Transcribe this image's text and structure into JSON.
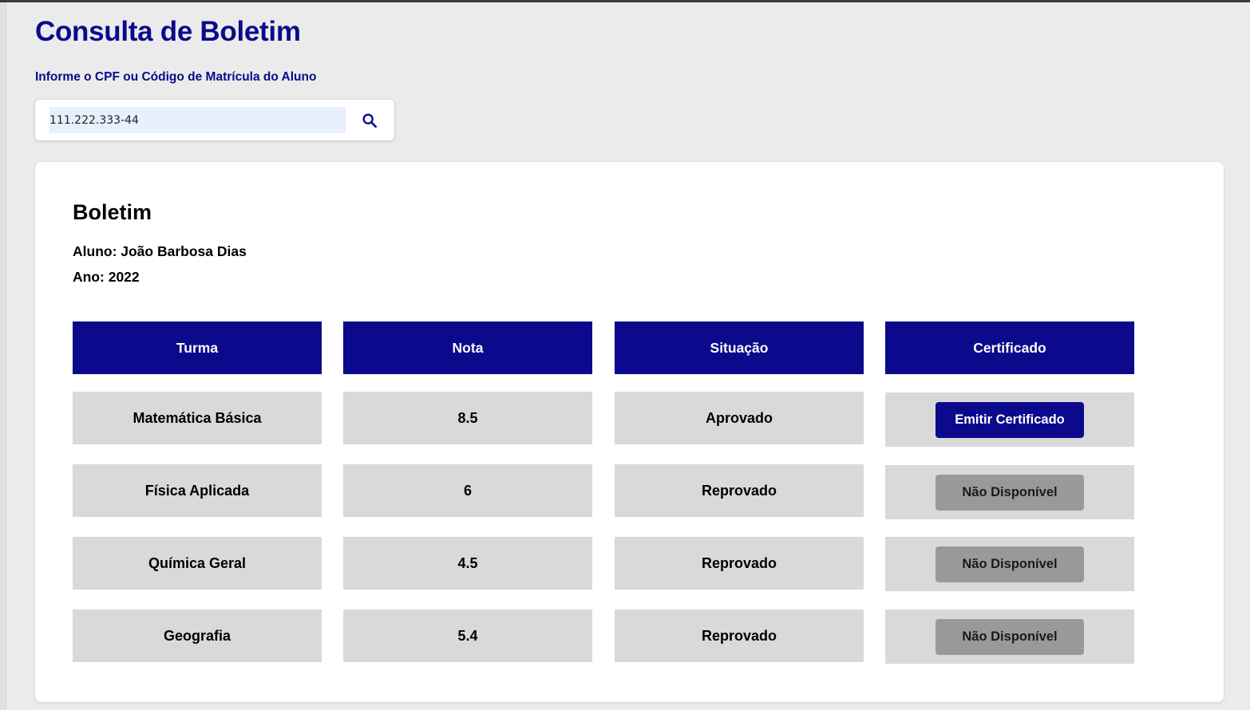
{
  "page": {
    "title": "Consulta de Boletim",
    "search_label": "Informe o CPF ou Código de Matrícula do Aluno",
    "search_value": "111.222.333-44",
    "search_icon": "search-icon"
  },
  "report": {
    "title": "Boletim",
    "student_line": "Aluno: João Barbosa Dias",
    "year_line": "Ano: 2022",
    "headers": {
      "turma": "Turma",
      "nota": "Nota",
      "situacao": "Situação",
      "certificado": "Certificado"
    },
    "rows": [
      {
        "turma": "Matemática Básica",
        "nota": "8.5",
        "situacao": "Aprovado",
        "certificado": "Emitir Certificado",
        "cert_enabled": true
      },
      {
        "turma": "Física Aplicada",
        "nota": "6",
        "situacao": "Reprovado",
        "certificado": "Não Disponível",
        "cert_enabled": false
      },
      {
        "turma": "Química Geral",
        "nota": "4.5",
        "situacao": "Reprovado",
        "certificado": "Não Disponível",
        "cert_enabled": false
      },
      {
        "turma": "Geografia",
        "nota": "5.4",
        "situacao": "Reprovado",
        "certificado": "Não Disponível",
        "cert_enabled": false
      }
    ]
  },
  "colors": {
    "brand": "#0b0a8c",
    "cell_bg": "#d9d9d9",
    "disabled_button": "#999999",
    "page_bg": "#ebebeb"
  }
}
